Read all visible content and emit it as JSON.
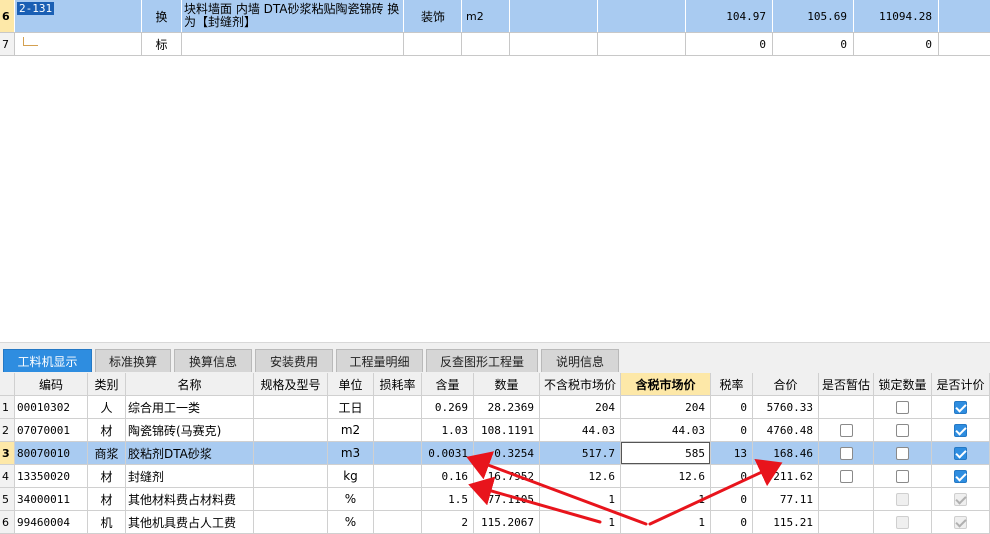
{
  "upper": {
    "rows": [
      {
        "num": "6",
        "code": "2-131",
        "type": "换",
        "name": "块料墙面 内墙 DTA砂浆粘贴陶瓷锦砖 换为【封缝剂】",
        "specialty": "装饰",
        "unit": "m2",
        "v1": "104.97",
        "v2": "105.69",
        "v3": "11094.28"
      },
      {
        "num": "7",
        "code": "",
        "type": "标",
        "name": "",
        "specialty": "",
        "unit": "",
        "v1": "0",
        "v2": "0",
        "v3": "0"
      }
    ]
  },
  "tabs": [
    "工料机显示",
    "标准换算",
    "换算信息",
    "安装费用",
    "工程量明细",
    "反查图形工程量",
    "说明信息"
  ],
  "grid": {
    "headers": [
      "",
      "编码",
      "类别",
      "名称",
      "规格及型号",
      "单位",
      "损耗率",
      "含量",
      "数量",
      "不含税市场价",
      "含税市场价",
      "税率",
      "合价",
      "是否暂估",
      "锁定数量",
      "是否计价"
    ],
    "rows": [
      {
        "num": "1",
        "code": "00010302",
        "type": "人",
        "name": "综合用工一类",
        "spec": "",
        "unit": "工日",
        "loss": "",
        "content": "0.269",
        "qty": "28.2369",
        "price_ex": "204",
        "price_inc": "204",
        "tax": "0",
        "total": "5760.33",
        "temp": "",
        "lock": "off",
        "priced": "on"
      },
      {
        "num": "2",
        "code": "07070001",
        "type": "材",
        "name": "陶瓷锦砖(马赛克)",
        "spec": "",
        "unit": "m2",
        "loss": "",
        "content": "1.03",
        "qty": "108.1191",
        "price_ex": "44.03",
        "price_inc": "44.03",
        "tax": "0",
        "total": "4760.48",
        "temp": "off",
        "lock": "off",
        "priced": "on"
      },
      {
        "num": "3",
        "code": "80070010",
        "type": "商浆",
        "name": "胶粘剂DTA砂浆",
        "spec": "",
        "unit": "m3",
        "loss": "",
        "content": "0.0031",
        "qty": "0.3254",
        "price_ex": "517.7",
        "price_inc": "585",
        "tax": "13",
        "total": "168.46",
        "temp": "off",
        "lock": "off",
        "priced": "on"
      },
      {
        "num": "4",
        "code": "13350020",
        "type": "材",
        "name": "封缝剂",
        "spec": "",
        "unit": "kg",
        "loss": "",
        "content": "0.16",
        "qty": "16.7952",
        "price_ex": "12.6",
        "price_inc": "12.6",
        "tax": "0",
        "total": "211.62",
        "temp": "off",
        "lock": "off",
        "priced": "on"
      },
      {
        "num": "5",
        "code": "34000011",
        "type": "材",
        "name": "其他材料费占材料费",
        "spec": "",
        "unit": "%",
        "loss": "",
        "content": "1.5",
        "qty": "77.1105",
        "price_ex": "1",
        "price_inc": "1",
        "tax": "0",
        "total": "77.11",
        "temp": "",
        "lock": "dis",
        "priced": "dis-on"
      },
      {
        "num": "6",
        "code": "99460004",
        "type": "机",
        "name": "其他机具费占人工费",
        "spec": "",
        "unit": "%",
        "loss": "",
        "content": "2",
        "qty": "115.2067",
        "price_ex": "1",
        "price_inc": "1",
        "tax": "0",
        "total": "115.21",
        "temp": "",
        "lock": "dis",
        "priced": "dis-on"
      }
    ]
  },
  "colors": {
    "selection": "#a9cbf1",
    "tab_active": "#2e8de0",
    "header_highlight": "#fde8a8",
    "annotation_arrow": "#e8141c"
  }
}
